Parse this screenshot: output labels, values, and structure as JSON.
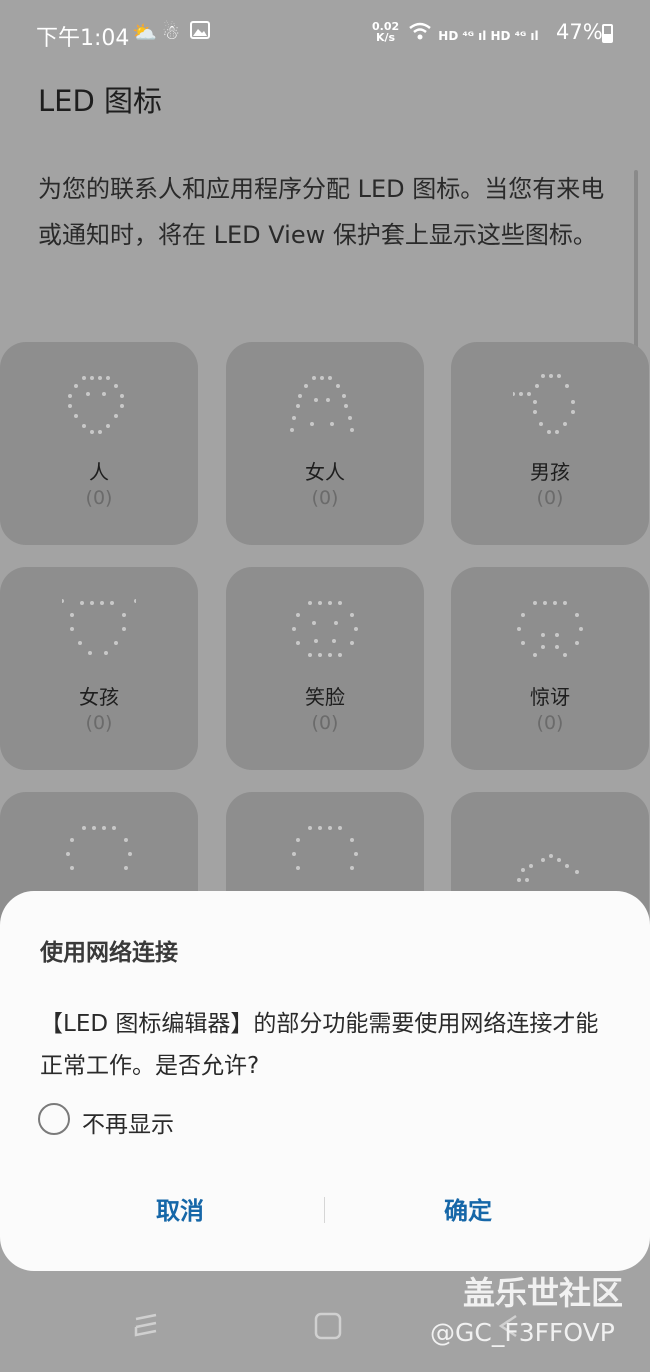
{
  "status_bar": {
    "time": "下午1:04",
    "icons": [
      "weather-icon",
      "app-icon",
      "image-icon"
    ],
    "net_speed_value": "0.02",
    "net_speed_unit": "K/s",
    "signal_text": "HD ⁴ᴳ ıl HD ⁴ᴳ ıl",
    "battery": "47%",
    "battery_level": 0.47
  },
  "page": {
    "title": "LED 图标",
    "description": "为您的联系人和应用程序分配 LED 图标。当您有来电或通知时，将在 LED View 保护套上显示这些图标。"
  },
  "icons": [
    {
      "name": "人",
      "count": "(0)"
    },
    {
      "name": "女人",
      "count": "(0)"
    },
    {
      "name": "男孩",
      "count": "(0)"
    },
    {
      "name": "女孩",
      "count": "(0)"
    },
    {
      "name": "笑脸",
      "count": "(0)"
    },
    {
      "name": "惊讶",
      "count": "(0)"
    },
    {
      "name": "",
      "count": ""
    },
    {
      "name": "",
      "count": ""
    },
    {
      "name": "",
      "count": ""
    }
  ],
  "dialog": {
    "title": "使用网络连接",
    "message": "【LED 图标编辑器】的部分功能需要使用网络连接才能正常工作。是否允许?",
    "checkbox_label": "不再显示",
    "checkbox_checked": false,
    "cancel_label": "取消",
    "confirm_label": "确定",
    "accent_color": "#1667a8"
  },
  "watermark": {
    "main": "盖乐世社区",
    "sub": "@GC_F3FFOVP"
  }
}
